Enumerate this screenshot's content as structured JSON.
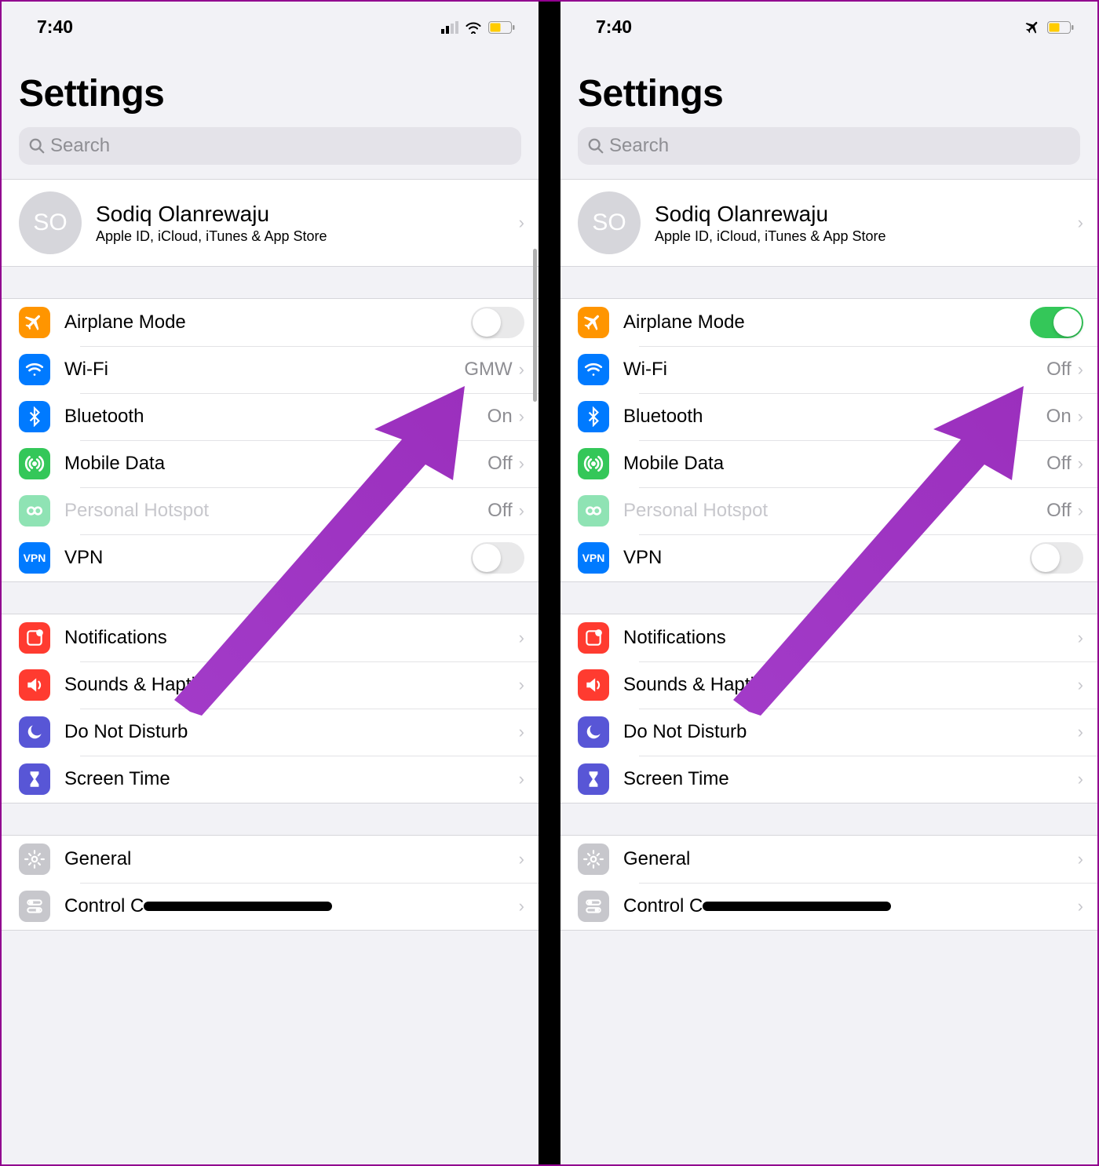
{
  "phones": [
    {
      "status": {
        "time": "7:40",
        "mode": "normal"
      },
      "header": {
        "title": "Settings",
        "searchPlaceholder": "Search"
      },
      "profile": {
        "initials": "SO",
        "name": "Sodiq Olanrewaju",
        "sub": "Apple ID, iCloud, iTunes & App Store"
      },
      "conn": {
        "airplane": {
          "label": "Airplane Mode",
          "on": false
        },
        "wifi": {
          "label": "Wi-Fi",
          "value": "GMW"
        },
        "bluetooth": {
          "label": "Bluetooth",
          "value": "On"
        },
        "mobile": {
          "label": "Mobile Data",
          "value": "Off"
        },
        "hotspot": {
          "label": "Personal Hotspot",
          "value": "Off",
          "disabled": true
        },
        "vpn": {
          "label": "VPN",
          "on": false,
          "badge": "VPN"
        }
      },
      "general": {
        "notifications": "Notifications",
        "sounds": "Sounds & Haptics",
        "dnd": "Do Not Disturb",
        "screentime": "Screen Time"
      },
      "system": {
        "general": "General",
        "control": "Control Centre"
      }
    },
    {
      "status": {
        "time": "7:40",
        "mode": "airplane"
      },
      "header": {
        "title": "Settings",
        "searchPlaceholder": "Search"
      },
      "profile": {
        "initials": "SO",
        "name": "Sodiq Olanrewaju",
        "sub": "Apple ID, iCloud, iTunes & App Store"
      },
      "conn": {
        "airplane": {
          "label": "Airplane Mode",
          "on": true
        },
        "wifi": {
          "label": "Wi-Fi",
          "value": "Off"
        },
        "bluetooth": {
          "label": "Bluetooth",
          "value": "On"
        },
        "mobile": {
          "label": "Mobile Data",
          "value": "Off"
        },
        "hotspot": {
          "label": "Personal Hotspot",
          "value": "Off",
          "disabled": true
        },
        "vpn": {
          "label": "VPN",
          "on": false,
          "badge": "VPN"
        }
      },
      "general": {
        "notifications": "Notifications",
        "sounds": "Sounds & Haptics",
        "dnd": "Do Not Disturb",
        "screentime": "Screen Time"
      },
      "system": {
        "general": "General",
        "control": "Control Centre"
      }
    }
  ]
}
